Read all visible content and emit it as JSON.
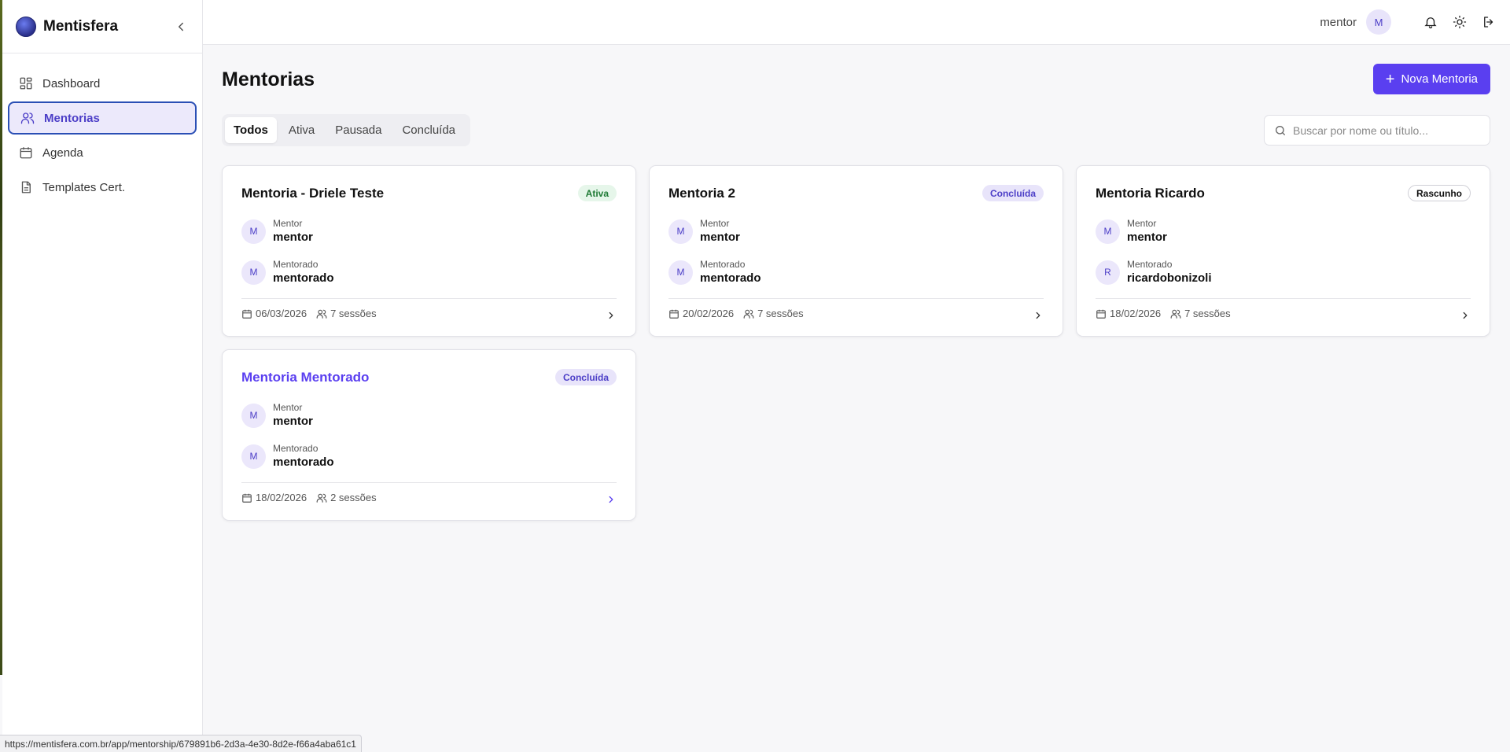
{
  "brand": {
    "name": "Mentisfera"
  },
  "sidebar": {
    "items": [
      {
        "label": "Dashboard"
      },
      {
        "label": "Mentorias"
      },
      {
        "label": "Agenda"
      },
      {
        "label": "Templates Cert."
      }
    ]
  },
  "topbar": {
    "user_name": "mentor",
    "avatar_initial": "M"
  },
  "page": {
    "title": "Mentorias",
    "new_button_label": "Nova Mentoria"
  },
  "tabs": [
    {
      "label": "Todos",
      "active": true
    },
    {
      "label": "Ativa",
      "active": false
    },
    {
      "label": "Pausada",
      "active": false
    },
    {
      "label": "Concluída",
      "active": false
    }
  ],
  "search": {
    "placeholder": "Buscar por nome ou título...",
    "value": ""
  },
  "cards": [
    {
      "title": "Mentoria - Driele Teste",
      "status": "Ativa",
      "mentor_role": "Mentor",
      "mentor_name": "mentor",
      "mentor_initial": "M",
      "mentee_role": "Mentorado",
      "mentee_name": "mentorado",
      "mentee_initial": "M",
      "date": "06/03/2026",
      "sessions": "7 sessões"
    },
    {
      "title": "Mentoria 2",
      "status": "Concluída",
      "mentor_role": "Mentor",
      "mentor_name": "mentor",
      "mentor_initial": "M",
      "mentee_role": "Mentorado",
      "mentee_name": "mentorado",
      "mentee_initial": "M",
      "date": "20/02/2026",
      "sessions": "7 sessões"
    },
    {
      "title": "Mentoria Ricardo",
      "status": "Rascunho",
      "mentor_role": "Mentor",
      "mentor_name": "mentor",
      "mentor_initial": "M",
      "mentee_role": "Mentorado",
      "mentee_name": "ricardobonizoli",
      "mentee_initial": "R",
      "date": "18/02/2026",
      "sessions": "7 sessões"
    },
    {
      "title": "Mentoria Mentorado",
      "status": "Concluída",
      "mentor_role": "Mentor",
      "mentor_name": "mentor",
      "mentor_initial": "M",
      "mentee_role": "Mentorado",
      "mentee_name": "mentorado",
      "mentee_initial": "M",
      "date": "18/02/2026",
      "sessions": "2 sessões"
    }
  ],
  "status_bar": {
    "url": "https://mentisfera.com.br/app/mentorship/679891b6-2d3a-4e30-8d2e-f66a4aba61c1"
  },
  "colors": {
    "accent": "#5a3ff0",
    "active_badge": "#1f7a35",
    "concluded_badge": "#4c3ec7"
  },
  "icons": [
    "collapse-icon",
    "dashboard-icon",
    "users-icon",
    "calendar-icon",
    "file-icon",
    "bell-icon",
    "sun-icon",
    "logout-icon",
    "plus-icon",
    "search-icon",
    "chevron-right-icon"
  ]
}
